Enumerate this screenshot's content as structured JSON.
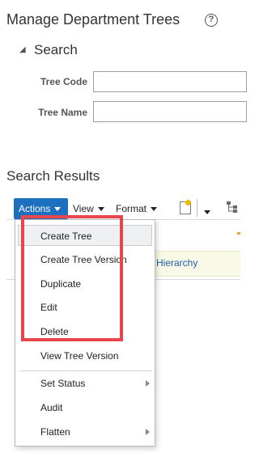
{
  "page": {
    "title": "Manage Department Trees"
  },
  "search": {
    "section_label": "Search",
    "tree_code_label": "Tree Code",
    "tree_name_label": "Tree Name",
    "tree_code_value": "",
    "tree_name_value": ""
  },
  "results": {
    "title": "Search Results",
    "row_text": "Hierarchy"
  },
  "toolbar": {
    "actions_label": "Actions",
    "view_label": "View",
    "format_label": "Format"
  },
  "menu": {
    "items": [
      {
        "label": "Create Tree"
      },
      {
        "label": "Create Tree Version"
      },
      {
        "label": "Duplicate"
      },
      {
        "label": "Edit"
      },
      {
        "label": "Delete"
      },
      {
        "label": "View Tree Version"
      },
      {
        "label": "Set Status"
      },
      {
        "label": "Audit"
      },
      {
        "label": "Flatten"
      }
    ]
  },
  "colors": {
    "accent": "#1d6fbf",
    "highlight_box": "#e8454f",
    "link": "#1a5fa8"
  },
  "icons": {
    "help": "help-circle-icon",
    "collapse": "triangle-collapse-icon",
    "new_tree": "new-document-icon",
    "hierarchy": "tree-hierarchy-icon"
  }
}
